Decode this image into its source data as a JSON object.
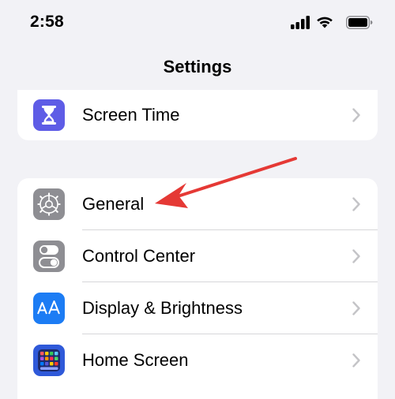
{
  "status_bar": {
    "time": "2:58",
    "icons": [
      "signal-icon",
      "wifi-icon",
      "battery-icon"
    ]
  },
  "nav": {
    "title": "Settings"
  },
  "groups": [
    {
      "items": [
        {
          "label": "Screen Time",
          "icon": "hourglass-icon",
          "icon_bg": "#5e5ce6"
        }
      ]
    },
    {
      "items": [
        {
          "label": "General",
          "icon": "gear-icon",
          "icon_bg": "#8e8e93"
        },
        {
          "label": "Control Center",
          "icon": "toggles-icon",
          "icon_bg": "#8e8e93"
        },
        {
          "label": "Display & Brightness",
          "icon": "text-size-icon",
          "icon_bg": "#1c7cf4"
        },
        {
          "label": "Home Screen",
          "icon": "app-grid-icon",
          "icon_bg": "#2f59d9"
        }
      ]
    }
  ],
  "annotation": {
    "type": "red-arrow",
    "color": "#e53935",
    "points_to": "General"
  },
  "colors": {
    "background": "#f2f2f6",
    "cell": "#ffffff",
    "chevron": "#c4c4c7",
    "separator": "#d6d6d9"
  }
}
